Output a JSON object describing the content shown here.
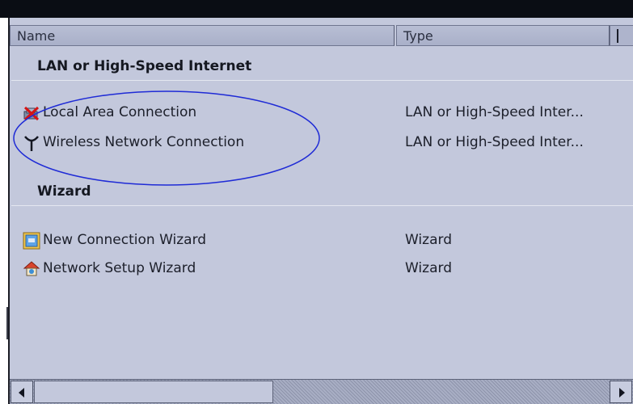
{
  "columns": {
    "name": "Name",
    "type": "Type"
  },
  "groups": [
    {
      "title": "LAN or High-Speed Internet",
      "items": [
        {
          "name": "Local Area Connection",
          "type": "LAN or High-Speed Inter...",
          "icon": "disabled-network-connection-icon"
        },
        {
          "name": "Wireless Network Connection",
          "type": "LAN or High-Speed Inter...",
          "icon": "wireless-antenna-icon"
        }
      ]
    },
    {
      "title": "Wizard",
      "items": [
        {
          "name": "New Connection Wizard",
          "type": "Wizard",
          "icon": "new-connection-wizard-icon"
        },
        {
          "name": "Network Setup Wizard",
          "type": "Wizard",
          "icon": "network-setup-wizard-icon"
        }
      ]
    }
  ],
  "colors": {
    "pane_background": "#c3c8dc",
    "annotation_ellipse": "#1f2bd6"
  }
}
